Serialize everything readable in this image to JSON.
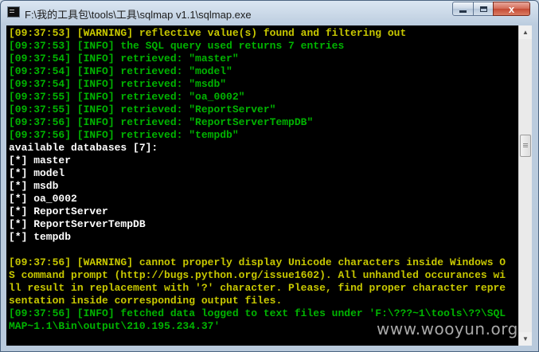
{
  "window": {
    "title": "F:\\我的工具包\\tools\\工具\\sqlmap v1.1\\sqlmap.exe",
    "minimize_glyph": "",
    "maximize_glyph": "",
    "close_glyph": "x"
  },
  "colors": {
    "console_bg": "#000000",
    "warning_text": "#c8c800",
    "info_text": "#00b400",
    "plain_text": "#ffffff"
  },
  "console": {
    "lines": [
      {
        "text": "[09:37:53] [WARNING] reflective value(s) found and filtering out",
        "kind": "warning"
      },
      {
        "text": "[09:37:53] [INFO] the SQL query used returns 7 entries",
        "kind": "info"
      },
      {
        "text": "[09:37:54] [INFO] retrieved: \"master\"",
        "kind": "info"
      },
      {
        "text": "[09:37:54] [INFO] retrieved: \"model\"",
        "kind": "info"
      },
      {
        "text": "[09:37:54] [INFO] retrieved: \"msdb\"",
        "kind": "info"
      },
      {
        "text": "[09:37:55] [INFO] retrieved: \"oa_0002\"",
        "kind": "info"
      },
      {
        "text": "[09:37:55] [INFO] retrieved: \"ReportServer\"",
        "kind": "info"
      },
      {
        "text": "[09:37:56] [INFO] retrieved: \"ReportServerTempDB\"",
        "kind": "info"
      },
      {
        "text": "[09:37:56] [INFO] retrieved: \"tempdb\"",
        "kind": "info"
      },
      {
        "text": "available databases [7]:",
        "kind": "plain"
      },
      {
        "text": "[*] master",
        "kind": "plain"
      },
      {
        "text": "[*] model",
        "kind": "plain"
      },
      {
        "text": "[*] msdb",
        "kind": "plain"
      },
      {
        "text": "[*] oa_0002",
        "kind": "plain"
      },
      {
        "text": "[*] ReportServer",
        "kind": "plain"
      },
      {
        "text": "[*] ReportServerTempDB",
        "kind": "plain"
      },
      {
        "text": "[*] tempdb",
        "kind": "plain"
      },
      {
        "text": "",
        "kind": "plain"
      },
      {
        "text": "[09:37:56] [WARNING] cannot properly display Unicode characters inside Windows O",
        "kind": "warning"
      },
      {
        "text": "S command prompt (http://bugs.python.org/issue1602). All unhandled occurances wi",
        "kind": "warning"
      },
      {
        "text": "ll result in replacement with '?' character. Please, find proper character repre",
        "kind": "warning"
      },
      {
        "text": "sentation inside corresponding output files.",
        "kind": "warning"
      },
      {
        "text": "[09:37:56] [INFO] fetched data logged to text files under 'F:\\???~1\\tools\\??\\SQL",
        "kind": "info"
      },
      {
        "text": "MAP~1.1\\Bin\\output\\210.195.234.37'",
        "kind": "info"
      }
    ]
  },
  "scrollbar": {
    "up_icon": "scroll-up-arrow",
    "down_icon": "scroll-down-arrow",
    "up_glyph": "▲",
    "down_glyph": "▼"
  },
  "watermark": {
    "text": "www.wooyun.org"
  }
}
